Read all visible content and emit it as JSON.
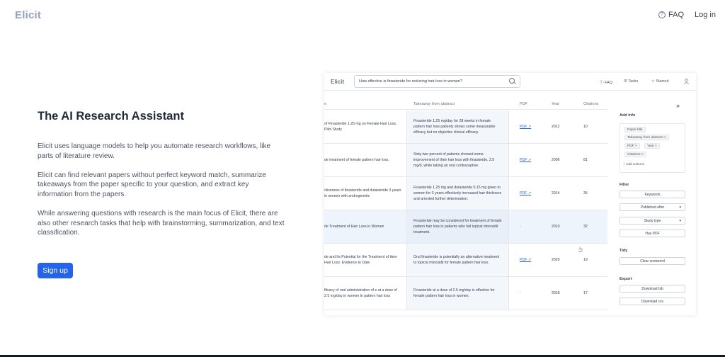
{
  "topbar": {
    "logo": "Elicit",
    "faq": "FAQ",
    "login": "Log in"
  },
  "hero": {
    "title": "The AI Research Assistant",
    "p1": "Elicit uses language models to help you automate research workflows, like parts of literature review.",
    "p2": "Elicit can find relevant papers without perfect keyword match, summarize takeaways from the paper specific to your question, and extract key information from the papers.",
    "p3": "While answering questions with research is the main focus of Elicit, there are also other research tasks that help with brainstorming, summarization, and text classification.",
    "signup": "Sign up"
  },
  "app": {
    "logo": "Elicit",
    "search_value": "How effective is finasteride for reducing hair loss in women?",
    "nav": {
      "faq": "FAQ",
      "tasks": "Tasks",
      "starred": "Starred"
    },
    "columns": {
      "title": "e",
      "takeaway": "Takeaway from abstract",
      "pdf": "PDF",
      "year": "Year",
      "citations": "Citations"
    },
    "rows": [
      {
        "title": "of Finasteride 1.25 mg on Female Hair Loss, Pilot Study",
        "takeaway": "Finasteride 1.25 mg/day for 28 weeks in female pattern hair loss patients shows some measurable efficacy but no objective clinical efficacy.",
        "pdf": "PDF",
        "year": "2012",
        "citations": "10"
      },
      {
        "title": "de treatment of female pattern hair loss.",
        "takeaway": "Sixty-two percent of patients showed some improvement of their hair loss with finasteride, 2.5 mg/d, while taking an oral contraceptive.",
        "pdf": "PDF",
        "year": "2006",
        "citations": "81"
      },
      {
        "title": "ctiveness of finasteride and dutasteride 3 years in women with androgenetic",
        "takeaway": "Finasteride 1.25 mg and dutasteride 0.15 mg given to women for 3 years effectively increased hair thickness and arrested further deterioration.",
        "pdf": "PDF",
        "year": "2014",
        "citations": "35"
      },
      {
        "title": "de Treatment of Hair Loss in Women",
        "takeaway": "Finasteride may be considered for treatment of female pattern hair loss in patients who fail topical minoxidil treatment.",
        "pdf": "-",
        "year": "2010",
        "citations": "32"
      },
      {
        "title": "de and Its Potential for the Treatment of ttern Hair Loss: Evidence to Date",
        "takeaway": "Oral finasteride is potentially an alternative treatment to topical minoxidil for female pattern hair loss.",
        "pdf": "PDF",
        "year": "2020",
        "citations": "19"
      },
      {
        "title": "fficacy of oral administration of e at a dose of 2.5 mg/day in women le pattern hair loss",
        "takeaway": "Finasteride at a dose of 2.5 mg/day is effective for female pattern hair loss in women.",
        "pdf": "-",
        "year": "2018",
        "citations": "17"
      }
    ],
    "side": {
      "collapse": "»",
      "add_info": "Add info",
      "chips": [
        "Paper title",
        "Takeaway from abstract",
        "PDF",
        "Year",
        "Citations"
      ],
      "add_column": "+ Add Column",
      "filter": "Filter",
      "keywords": "Keywords",
      "published_after": "Published after",
      "study_type": "Study type",
      "has_pdf": "Has PDF",
      "tidy": "Tidy",
      "clear_unstarred": "Clear unstarred",
      "export": "Export",
      "download_bib": "Download bib",
      "download_csv": "Download csv"
    }
  }
}
